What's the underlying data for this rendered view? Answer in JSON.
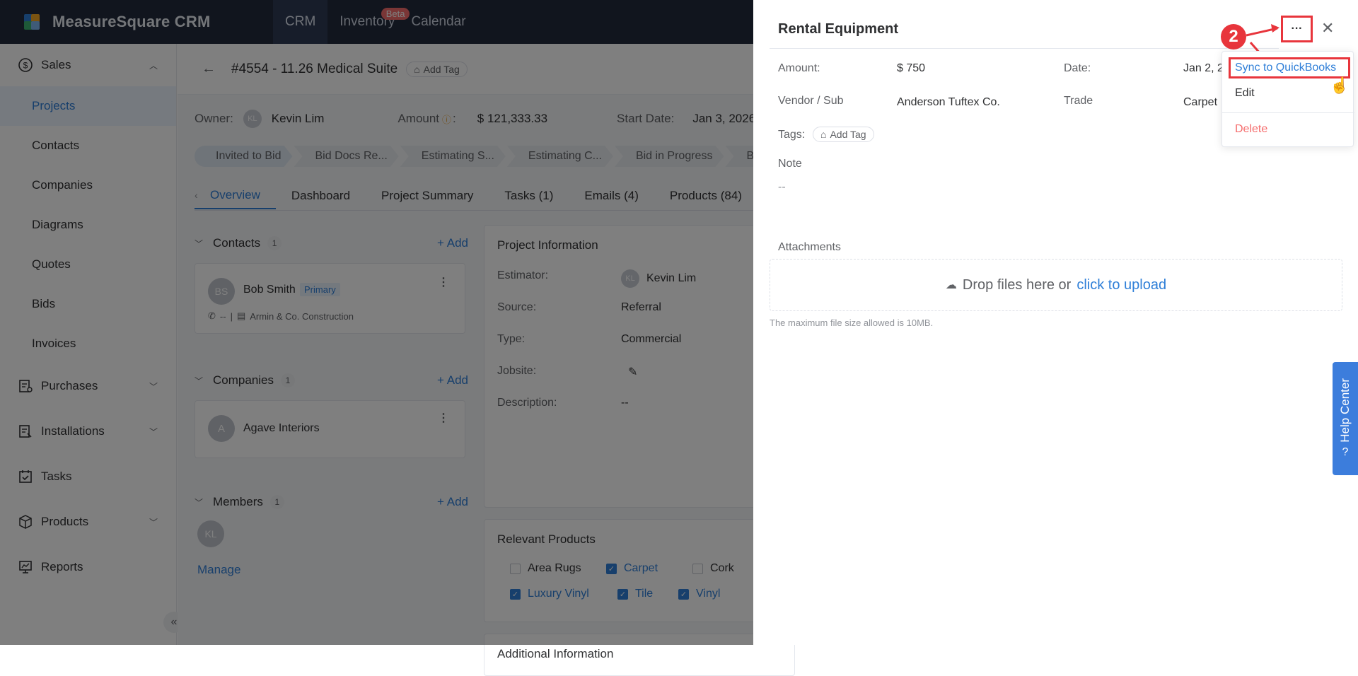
{
  "app": {
    "name": "MeasureSquare CRM"
  },
  "nav": {
    "items": [
      {
        "label": "CRM"
      },
      {
        "label": "Inventory",
        "badge": "Beta"
      },
      {
        "label": "Calendar"
      }
    ]
  },
  "sidebar": {
    "groups": [
      {
        "label": "Sales",
        "icon": "dollar-circle-icon",
        "expanded": true
      },
      {
        "label": "Purchases",
        "icon": "purchases-icon"
      },
      {
        "label": "Installations",
        "icon": "installations-icon"
      },
      {
        "label": "Tasks",
        "icon": "tasks-icon"
      },
      {
        "label": "Products",
        "icon": "box-icon"
      },
      {
        "label": "Reports",
        "icon": "reports-icon"
      }
    ],
    "sales_items": [
      "Projects",
      "Contacts",
      "Companies",
      "Diagrams",
      "Quotes",
      "Bids",
      "Invoices"
    ],
    "active_item": "Projects"
  },
  "project": {
    "title": "#4554 - 11.26 Medical Suite",
    "add_tag": "Add Tag",
    "owner_label": "Owner:",
    "owner_initials": "KL",
    "owner": "Kevin Lim",
    "amount_label": "Amount",
    "amount": "$ 121,333.33",
    "start_label": "Start Date:",
    "start": "Jan 3, 2026"
  },
  "stages": [
    "Invited to Bid",
    "Bid Docs Re...",
    "Estimating S...",
    "Estimating C...",
    "Bid in Progress",
    "Bid S"
  ],
  "tabs": [
    "Overview",
    "Dashboard",
    "Project Summary",
    "Tasks (1)",
    "Emails (4)",
    "Products (84)"
  ],
  "contacts": {
    "title": "Contacts",
    "count": "1",
    "add": "Add",
    "items": [
      {
        "initials": "BS",
        "name": "Bob Smith",
        "tag": "Primary",
        "phone": "--",
        "company": "Armin & Co. Construction"
      }
    ]
  },
  "companies": {
    "title": "Companies",
    "count": "1",
    "add": "Add",
    "items": [
      {
        "initial": "A",
        "name": "Agave Interiors"
      }
    ]
  },
  "members": {
    "title": "Members",
    "count": "1",
    "add": "Add",
    "initials": "KL",
    "manage": "Manage"
  },
  "project_info": {
    "title": "Project Information",
    "rows": [
      {
        "label": "Estimator:",
        "value": "Kevin Lim",
        "initials": "KL"
      },
      {
        "label": "Source:",
        "value": "Referral"
      },
      {
        "label": "Type:",
        "value": "Commercial"
      },
      {
        "label": "Jobsite:",
        "value": ""
      },
      {
        "label": "Description:",
        "value": "--"
      }
    ]
  },
  "relevant_products": {
    "title": "Relevant Products",
    "items": [
      {
        "label": "Area Rugs",
        "checked": false
      },
      {
        "label": "Carpet",
        "checked": true
      },
      {
        "label": "Cork",
        "checked": false
      },
      {
        "label": "Luxury Vinyl",
        "checked": true
      },
      {
        "label": "Tile",
        "checked": true
      },
      {
        "label": "Vinyl",
        "checked": true
      }
    ]
  },
  "additional_info": {
    "title": "Additional Information"
  },
  "drawer": {
    "title": "Rental Equipment",
    "amount_label": "Amount:",
    "amount": "$ 750",
    "date_label": "Date:",
    "date": "Jan 2, 2",
    "vendor_label": "Vendor / Sub",
    "vendor": "Anderson Tuftex Co.",
    "trade_label": "Trade",
    "trade": "Carpet",
    "tags_label": "Tags:",
    "add_tag": "Add Tag",
    "note_label": "Note",
    "note": "--",
    "attachments_label": "Attachments",
    "upload_text": "Drop files here or",
    "upload_link": "click to upload",
    "upload_hint": "The maximum file size allowed is 10MB."
  },
  "dropdown": {
    "sync": "Sync to QuickBooks",
    "edit": "Edit",
    "delete": "Delete"
  },
  "annotation": {
    "step": "2"
  },
  "help": {
    "label": "Help Center"
  },
  "colors": {
    "accent": "#2f7fd8",
    "danger": "#f56c6c",
    "topbar": "#222a3c",
    "highlight": "#e8353c"
  }
}
